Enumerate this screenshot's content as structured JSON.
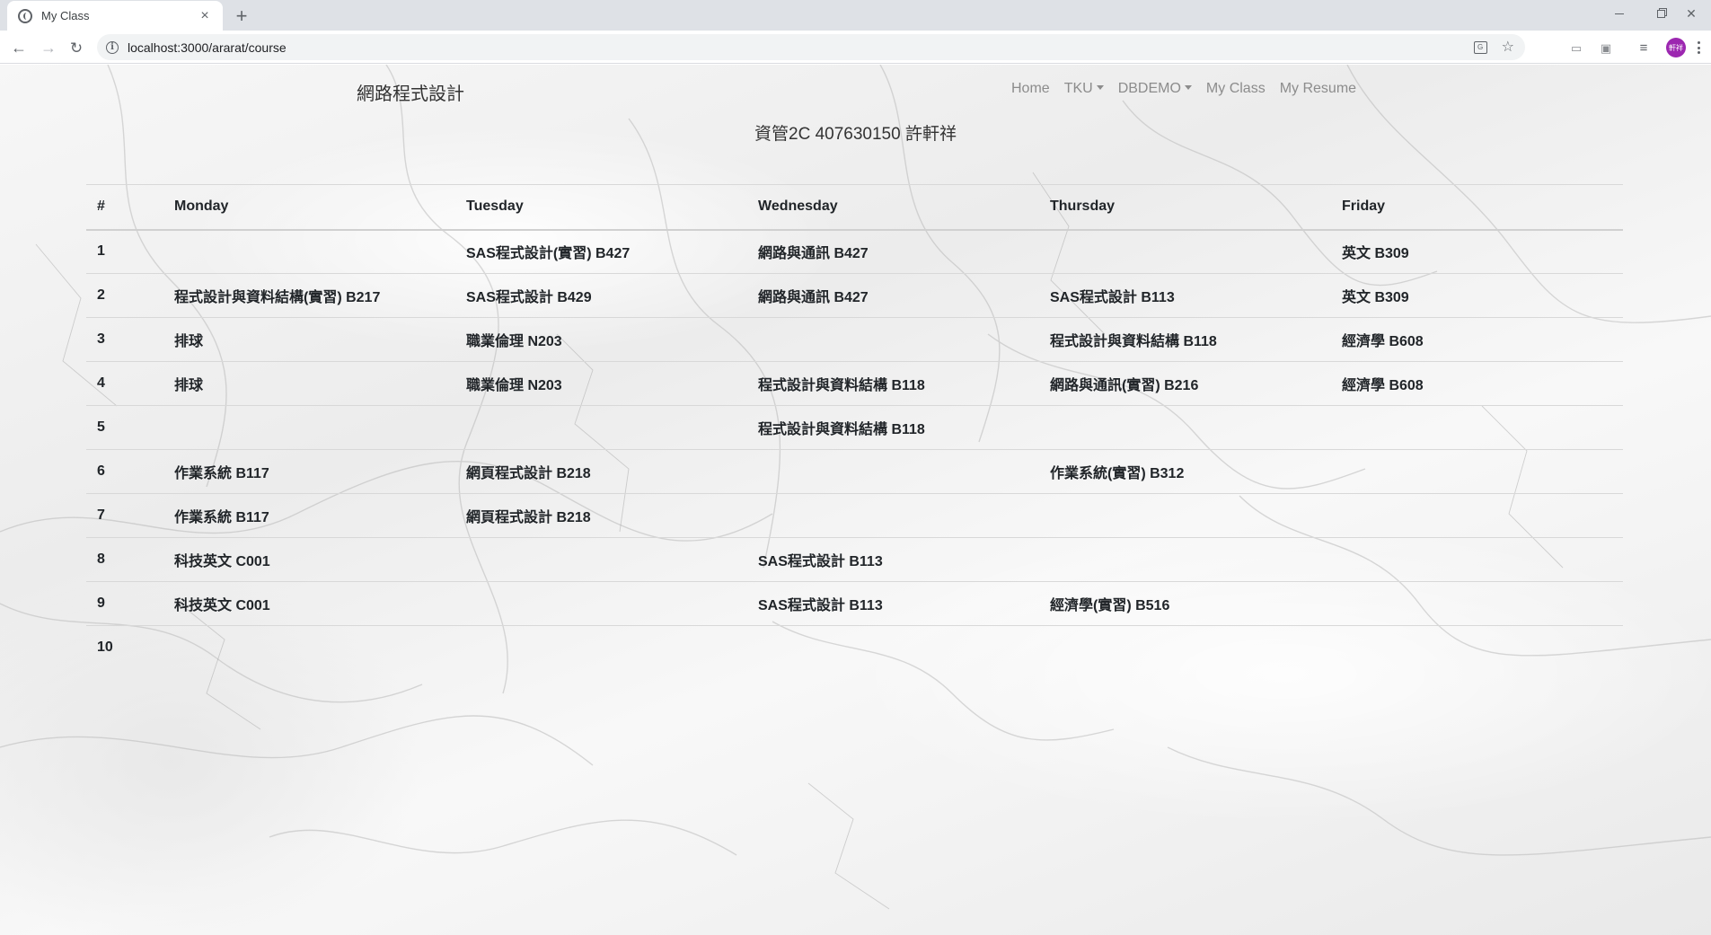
{
  "browser": {
    "tab_title": "My Class",
    "tab_close": "×",
    "new_tab": "+",
    "url": "localhost:3000/ararat/course",
    "avatar_text": "軒祥"
  },
  "site": {
    "brand": "網路程式設計",
    "nav": [
      "Home",
      "TKU",
      "DBDEMO",
      "My Class",
      "My Resume"
    ],
    "subtitle": "資管2C 407630150 許軒祥"
  },
  "schedule": {
    "headers": [
      "#",
      "Monday",
      "Tuesday",
      "Wednesday",
      "Thursday",
      "Friday"
    ],
    "rows": [
      [
        "1",
        "",
        "SAS程式設計(實習) B427",
        "網路與通訊 B427",
        "",
        "英文 B309"
      ],
      [
        "2",
        "程式設計與資料結構(實習) B217",
        "SAS程式設計 B429",
        "網路與通訊 B427",
        "SAS程式設計 B113",
        "英文 B309"
      ],
      [
        "3",
        "排球",
        "職業倫理 N203",
        "",
        "程式設計與資料結構 B118",
        "經濟學 B608"
      ],
      [
        "4",
        "排球",
        "職業倫理 N203",
        "程式設計與資料結構 B118",
        "網路與通訊(實習) B216",
        "經濟學 B608"
      ],
      [
        "5",
        "",
        "",
        "程式設計與資料結構 B118",
        "",
        ""
      ],
      [
        "6",
        "作業系統 B117",
        "網頁程式設計 B218",
        "",
        "作業系統(實習) B312",
        ""
      ],
      [
        "7",
        "作業系統 B117",
        "網頁程式設計 B218",
        "",
        "",
        ""
      ],
      [
        "8",
        "科技英文 C001",
        "",
        "SAS程式設計 B113",
        "",
        ""
      ],
      [
        "9",
        "科技英文 C001",
        "",
        "SAS程式設計 B113",
        "經濟學(實習) B516",
        ""
      ],
      [
        "10",
        "",
        "",
        "",
        "",
        ""
      ]
    ]
  }
}
